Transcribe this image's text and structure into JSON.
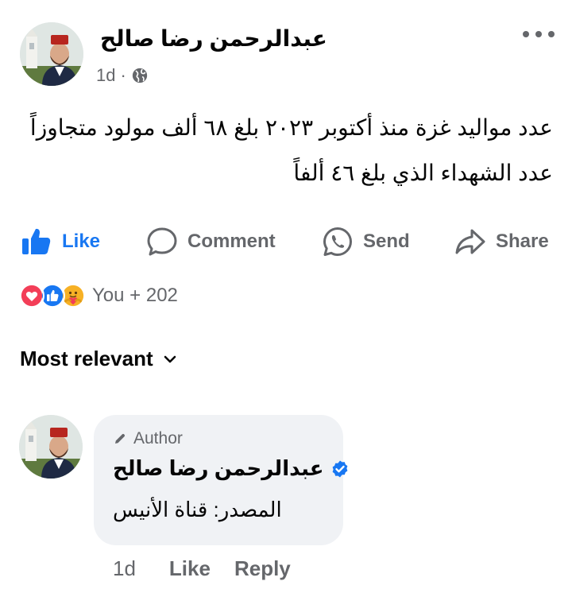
{
  "post": {
    "author": "عبدالرحمن رضا صالح",
    "time": "1d",
    "separator": "·",
    "privacy_icon": "globe-icon",
    "text_line1": "عدد مواليد غزة منذ أكتوبر ٢٠٢٣ بلغ ٦٨ ألف مولود متجاوزاً",
    "text_line2": "عدد الشهداء الذي بلغ ٤٦ ألفاً"
  },
  "actions": {
    "like": "Like",
    "comment": "Comment",
    "send": "Send",
    "share": "Share"
  },
  "reactions": {
    "icons": [
      "love-icon",
      "like-icon",
      "care-icon"
    ],
    "count": "You + 202"
  },
  "sort": {
    "label": "Most relevant"
  },
  "comment": {
    "badge": "Author",
    "author": "عبدالرحمن رضا صالح",
    "text": "المصدر: قناة الأنيس",
    "time": "1d",
    "like": "Like",
    "reply": "Reply"
  },
  "colors": {
    "brand": "#1877f2",
    "secondary_text": "#65676b",
    "bubble": "#f0f2f5"
  }
}
